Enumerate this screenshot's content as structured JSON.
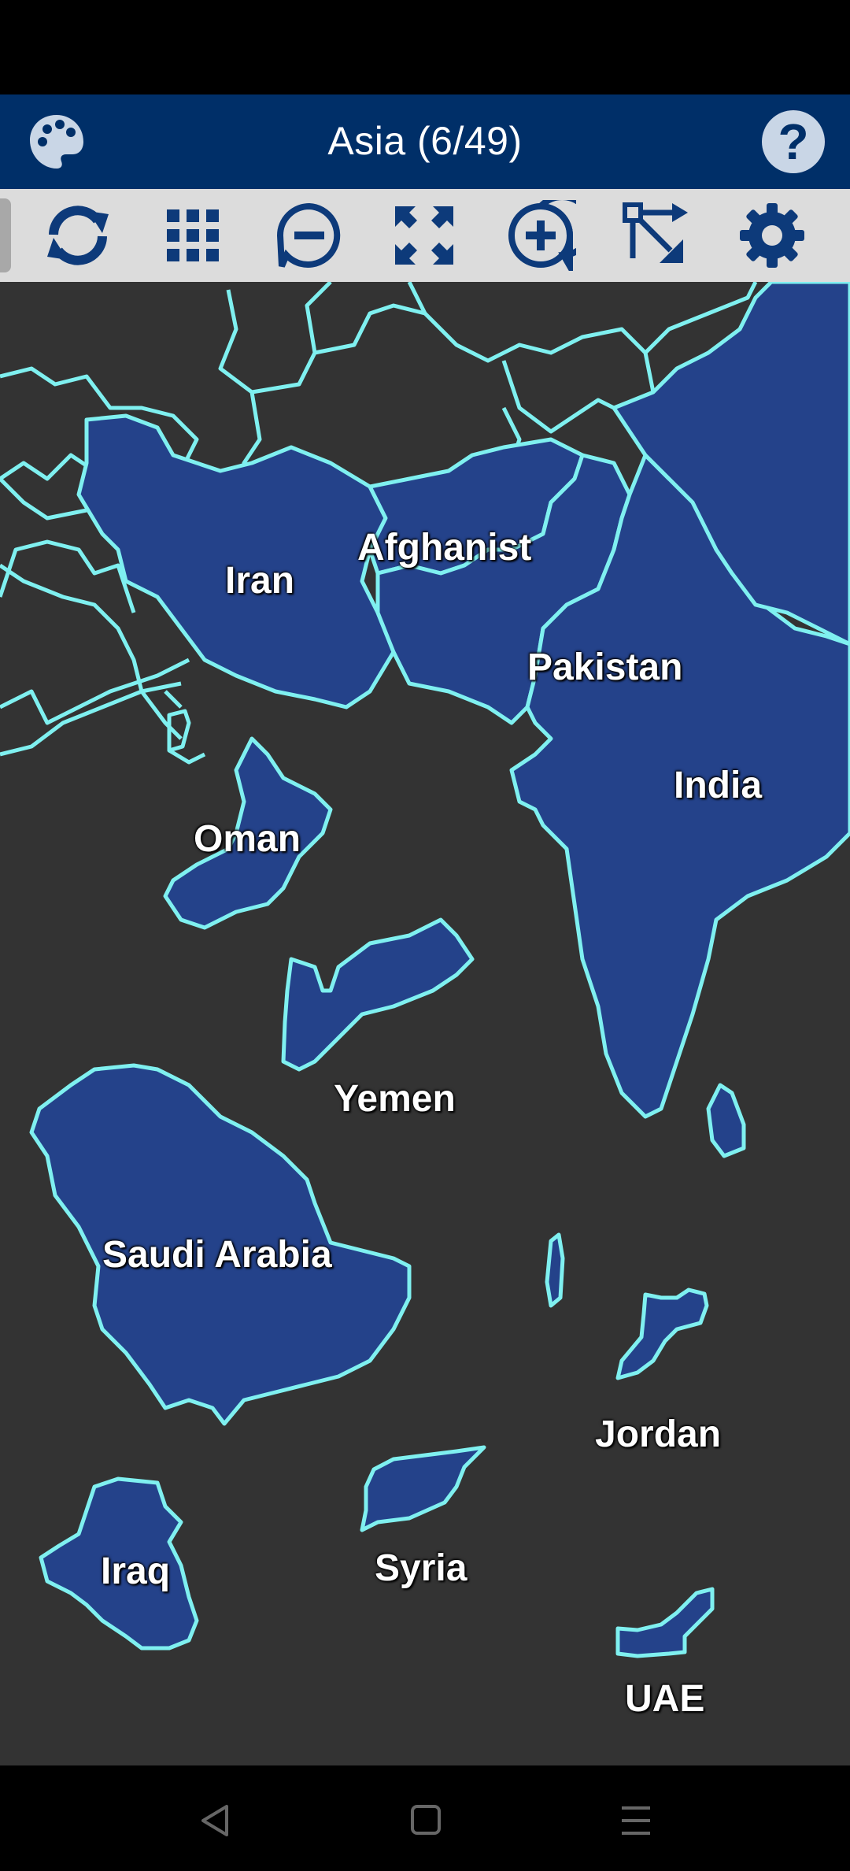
{
  "header": {
    "title": "Asia (6/49)",
    "help_label": "?"
  },
  "colors": {
    "header": "#002f68",
    "country_fill": "#24428a",
    "border": "#7ff0f0",
    "background": "#333333",
    "toolbar": "#dcdcdc"
  },
  "toolbar": {
    "buttons": [
      {
        "name": "refresh-icon"
      },
      {
        "name": "grid-icon"
      },
      {
        "name": "zoom-out-icon"
      },
      {
        "name": "fit-screen-icon"
      },
      {
        "name": "zoom-in-icon"
      },
      {
        "name": "move-pieces-icon"
      },
      {
        "name": "settings-icon"
      }
    ]
  },
  "map": {
    "placed_countries": [
      "Iran",
      "Afghanist",
      "Pakistan",
      "India",
      "Oman",
      "Yemen"
    ],
    "pieces": [
      "Saudi Arabia",
      "Jordan",
      "Iraq",
      "Syria",
      "UAE"
    ],
    "labels": {
      "iran": "Iran",
      "afghanistan": "Afghanist",
      "pakistan": "Pakistan",
      "india": "India",
      "oman": "Oman",
      "yemen": "Yemen",
      "saudi_arabia": "Saudi Arabia",
      "jordan": "Jordan",
      "iraq": "Iraq",
      "syria": "Syria",
      "uae": "UAE"
    }
  },
  "navbar": {
    "back": "back-icon",
    "home": "home-icon",
    "menu": "menu-icon"
  }
}
